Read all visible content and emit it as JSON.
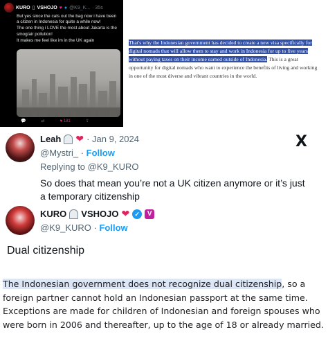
{
  "dark_tweet": {
    "name": "KURO",
    "brand": "VSHOJO",
    "handle": "@K9_K...",
    "time": "· 35s",
    "lines": [
      "But yes since the cats out the bag now i have been a citizen in Indonesia for quite a while now!",
      "The one thing i LOVE the most about Jakarta is the smog/air pollution!",
      "It makes me feel like im in the UK again"
    ],
    "like_count": "181"
  },
  "article": {
    "highlighted": "That's why the Indonesian government has decided to create a new visa specifically for digital nomads that will allow them to stay and work in Indonesia for up to five years without paying taxes on their income earned outside of Indonesia.",
    "rest": " This is a great opportunity for digital nomads who want to experience the benefits of living and working in one of the most diverse and vibrant countries in the world."
  },
  "leah_tweet": {
    "name": "Leah",
    "date": "· Jan 9, 2024",
    "handle": "@Mystri_",
    "follow": "Follow",
    "replying": "Replying to @K9_KURO",
    "text": "So does that mean you’re not a UK citizen anymore or it’s just a temporary citizenship"
  },
  "kuro_tweet": {
    "name": "KURO",
    "brand": "VSHOJO",
    "handle": "@K9_KURO",
    "follow": "Follow",
    "text": "Dual citizenship",
    "v_badge": "V"
  },
  "bottom": {
    "highlighted": "The Indonesian government does not recognize dual citizenship",
    "rest": ", so a foreign partner cannot hold an Indonesian passport at the same time. Exceptions are made for children of Indonesian and foreign spouses who were born in 2006 and thereafter, up to the age of 18 or already married."
  },
  "x_logo": "X"
}
